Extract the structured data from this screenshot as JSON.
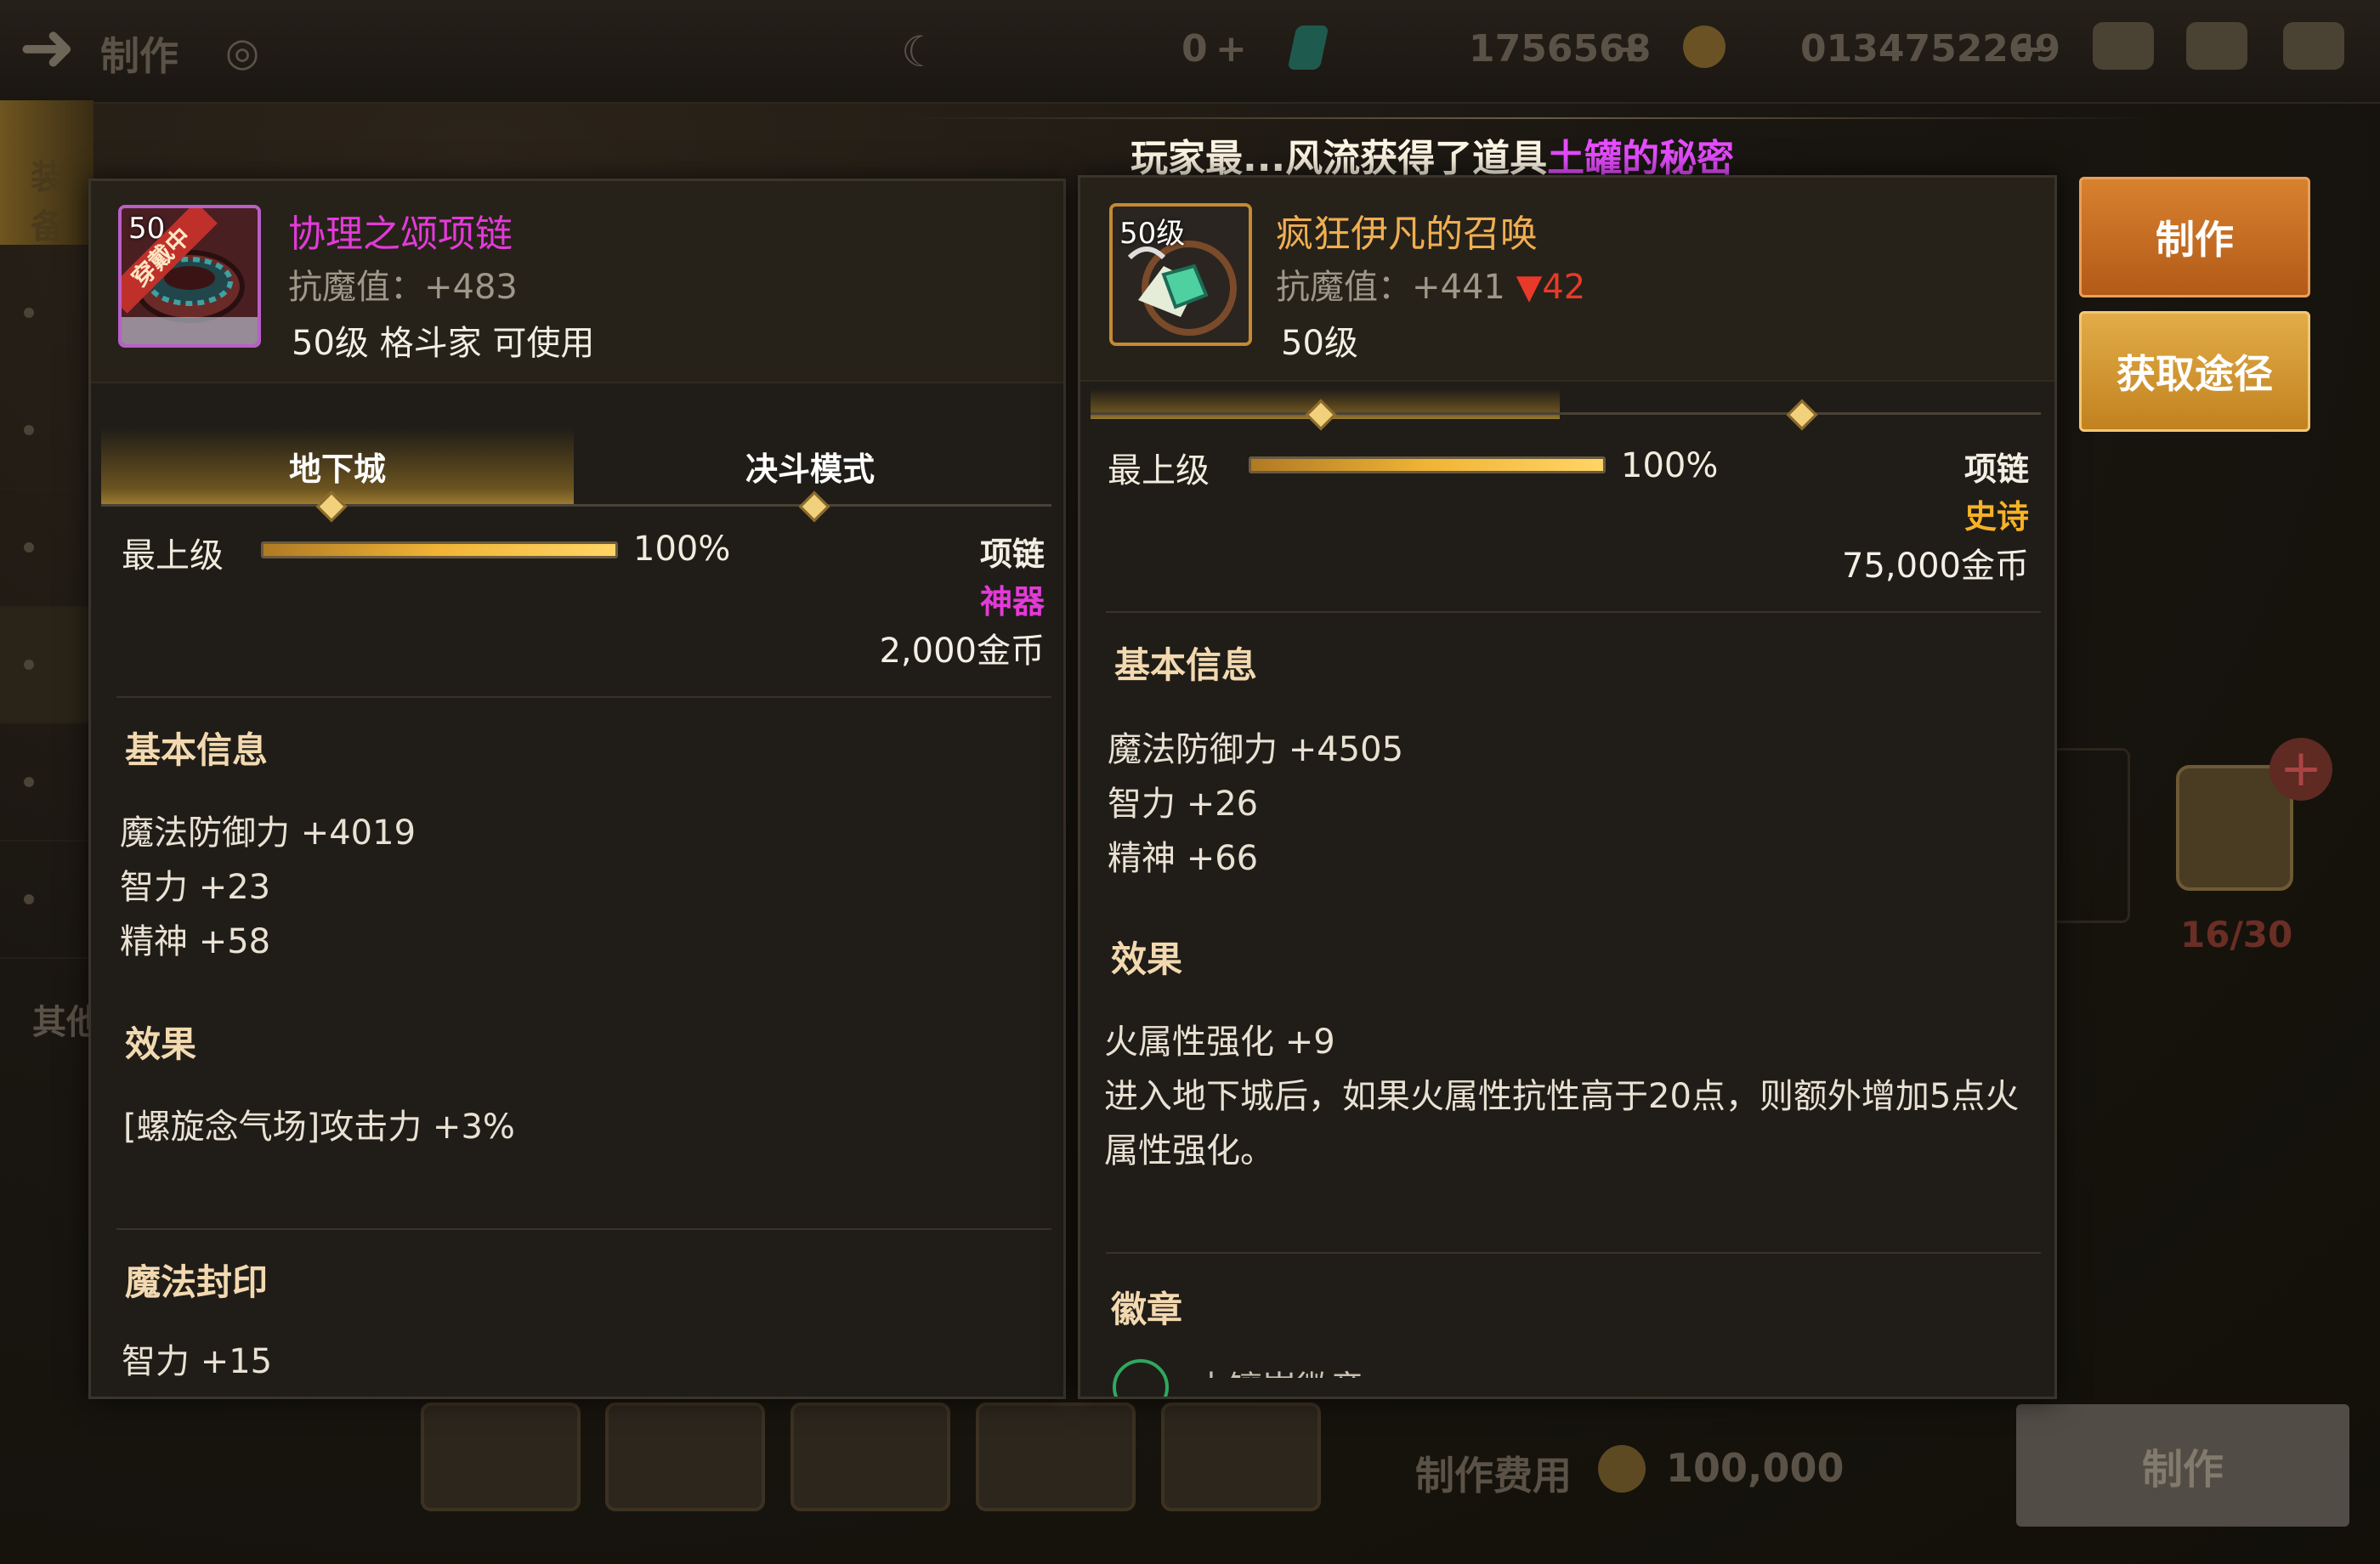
{
  "topbar": {
    "back_icon": "back-arrow-icon",
    "title": "制作",
    "currency_a": "0",
    "currency_b": "1756568",
    "currency_c": "0134752269",
    "plus": "+",
    "icons": [
      "chest-icon",
      "mail-icon",
      "chat-icon"
    ]
  },
  "ticker": {
    "prefix": "玩家最...风流获得了道具",
    "item": "土罐的秘密"
  },
  "background": {
    "left_tab": "装备",
    "left_other": "其他",
    "cost_label": "制作费用",
    "cost_value": "100,000",
    "make_button": "制作",
    "slot_count": "16/30"
  },
  "left_item": {
    "level_badge": "50",
    "equipped_ribbon": "穿戴中",
    "name": "协理之颂项链",
    "name_color": "#e33ad8",
    "magic_resist": "抗魔值：+483",
    "sub": "50级 格斗家 可使用",
    "tabs": [
      "地下城",
      "决斗模式"
    ],
    "max_label": "最上级",
    "max_percent": 1.0,
    "percent_text": "100%",
    "type": "项链",
    "rarity": "神器",
    "rarity_color": "#e33ad8",
    "price": "2,000金币",
    "basic_title": "基本信息",
    "basic": [
      "魔法防御力 +4019",
      "智力 +23",
      "精神 +58"
    ],
    "effect_title": "效果",
    "effects": [
      "[螺旋念气场]攻击力 +3%"
    ],
    "seal_title": "魔法封印",
    "seal": [
      "智力 +15"
    ]
  },
  "right_item": {
    "level_badge": "50级",
    "name": "疯狂伊凡的召唤",
    "name_color": "#f0ae52",
    "magic_resist": "抗魔值：+441",
    "resist_diff": "▼42",
    "sub": "50级",
    "max_label": "最上级",
    "max_percent": 1.0,
    "percent_text": "100%",
    "type": "项链",
    "rarity": "史诗",
    "rarity_color": "#f7b227",
    "price": "75,000金币",
    "basic_title": "基本信息",
    "basic": [
      "魔法防御力 +4505",
      "智力 +26",
      "精神 +66"
    ],
    "effect_title": "效果",
    "effects": [
      "火属性强化 +9",
      "进入地下城后，如果火属性抗性高于20点，则额外增加5点火",
      "属性强化。"
    ],
    "emblem_title": "徽章",
    "emblem_partial": "土镶嵌徽章"
  },
  "actions": {
    "make": "制作",
    "source": "获取途径"
  },
  "colors": {
    "accent_gold": "#f0b436",
    "artifact_purple": "#e33ad8",
    "epic_orange": "#f7b227",
    "make_button": "#c96a22",
    "source_button": "#d29632"
  }
}
